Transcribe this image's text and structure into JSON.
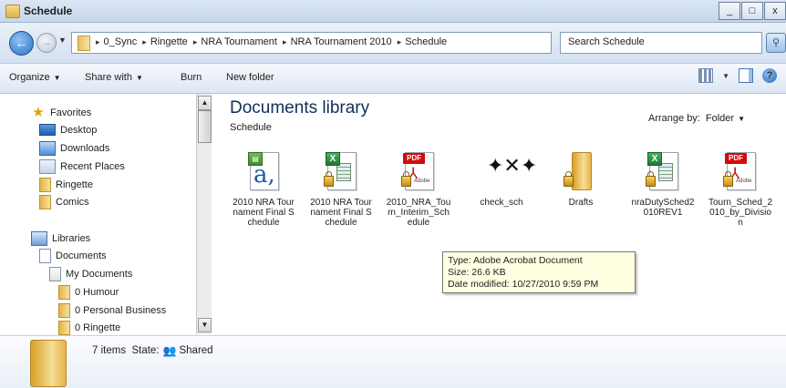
{
  "window": {
    "title": "Schedule",
    "controls": [
      "_",
      "□",
      "x"
    ]
  },
  "address": {
    "crumbs": [
      "0_Sync",
      "Ringette",
      "NRA Tournament",
      "NRA Tournament 2010",
      "Schedule"
    ],
    "search_placeholder": "Search Schedule"
  },
  "toolbar": {
    "organize": "Organize",
    "share_with": "Share with",
    "burn": "Burn",
    "new_folder": "New folder"
  },
  "nav": {
    "favorites": "Favorites",
    "desktop": "Desktop",
    "downloads": "Downloads",
    "recent": "Recent Places",
    "ringette": "Ringette",
    "comics": "Comics",
    "libraries": "Libraries",
    "documents": "Documents",
    "my_documents": "My Documents",
    "humour": "0 Humour",
    "personal_business": "0 Personal Business",
    "ringette_folder": "0 Ringette"
  },
  "content": {
    "header": "Documents library",
    "subheader": "Schedule",
    "arrange_label": "Arrange by:",
    "arrange_value": "Folder"
  },
  "files": [
    {
      "name": "2010 NRA Tournament Final Schedule",
      "icon": "shortcut-document-icon"
    },
    {
      "name": "2010 NRA Tournament Final Schedule",
      "icon": "excel-icon"
    },
    {
      "name": "2010_NRA_Tourn_Interim_Schedule",
      "icon": "pdf-icon"
    },
    {
      "name": "check_sch",
      "icon": "scribble-icon"
    },
    {
      "name": "Drafts",
      "icon": "folder-icon"
    },
    {
      "name": "nraDutySched2010REV1",
      "icon": "excel-icon"
    },
    {
      "name": "Tourn_Sched_2010_by_Division",
      "icon": "pdf-icon"
    }
  ],
  "tooltip": {
    "type": "Type: Adobe Acrobat Document",
    "size": "Size: 26.6 KB",
    "modified": "Date modified: 10/27/2010 9:59 PM"
  },
  "status": {
    "items": "7 items",
    "state_label": "State:",
    "state_value": "Shared"
  }
}
